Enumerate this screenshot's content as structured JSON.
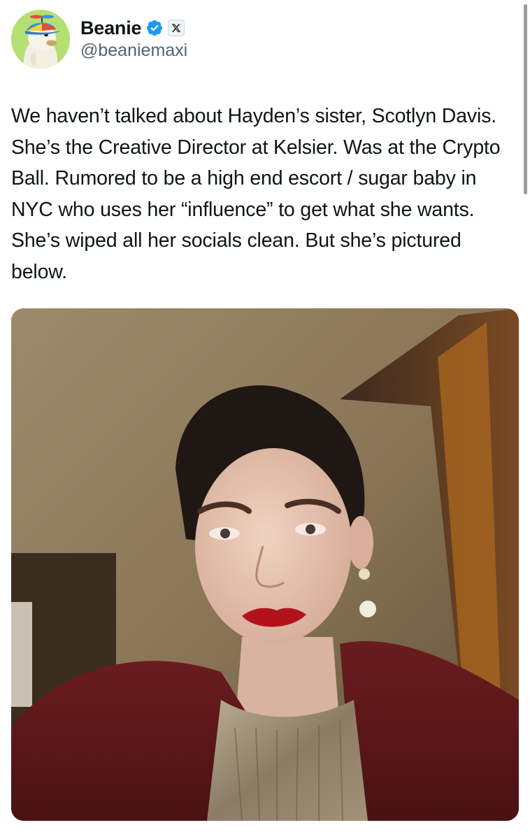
{
  "author": {
    "display_name": "Beanie",
    "handle": "@beaniemaxi",
    "verified": true,
    "avatar_icon": "duck-with-propeller-hat-icon",
    "affiliate_badge_icon": "x-logo-icon"
  },
  "tweet": {
    "text": "We haven’t talked about Hayden’s sister, Scotlyn Davis. She’s the Creative Director at Kelsier. Was at the Crypto Ball. Rumored to be a high end escort / sugar baby in NYC who uses her “influence” to get what she wants. She’s wiped all her socials clean. But she’s pictured below."
  },
  "media": {
    "type": "photo"
  },
  "colors": {
    "verified_blue": "#1d9bf0",
    "text_primary": "#0f1419",
    "text_secondary": "#536471"
  }
}
